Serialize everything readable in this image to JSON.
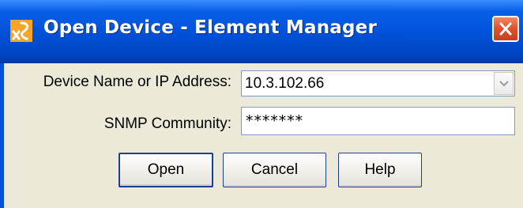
{
  "window": {
    "title": "Open Device - Element Manager",
    "icon": "app-logo-icon",
    "colors": {
      "titlebar": "#0050d8",
      "body": "#ece9d8",
      "close_button": "#e0542e",
      "field_border": "#7f9db9"
    }
  },
  "form": {
    "device_label": "Device Name or IP Address:",
    "device_value": "10.3.102.66",
    "snmp_label": "SNMP Community:",
    "snmp_value": "*******"
  },
  "buttons": {
    "open": "Open",
    "cancel": "Cancel",
    "help": "Help"
  }
}
